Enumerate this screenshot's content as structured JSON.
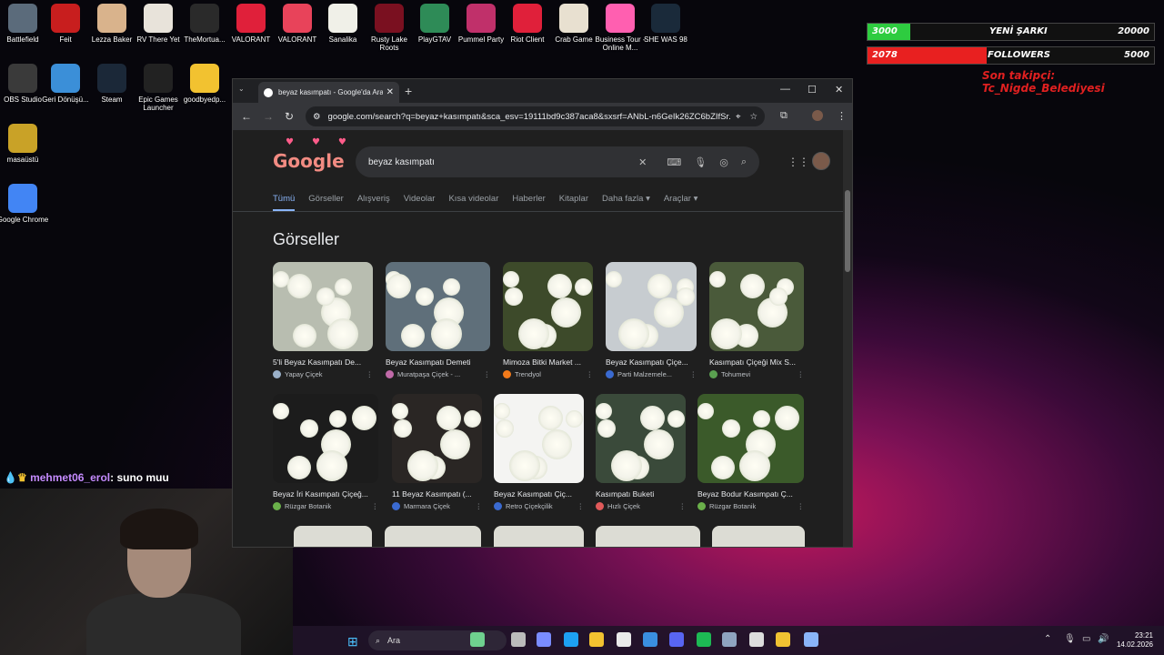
{
  "desktop": {
    "icons": [
      {
        "label": "Battlefield",
        "color": "#5b6b7b"
      },
      {
        "label": "Feit",
        "color": "#c81e1e"
      },
      {
        "label": "Lezza Baker",
        "color": "#d9b38c"
      },
      {
        "label": "RV There Yet",
        "color": "#e8e3da"
      },
      {
        "label": "TheMortua...",
        "color": "#2a2a2a"
      },
      {
        "label": "VALORANT",
        "color": "#e0203a"
      },
      {
        "label": "VALORANT",
        "color": "#e8435a"
      },
      {
        "label": "Sanalika",
        "color": "#f0f0e8"
      },
      {
        "label": "Rusty Lake Roots",
        "color": "#7a1020"
      },
      {
        "label": "PlayGTAV",
        "color": "#2e8b57"
      },
      {
        "label": "Pummel Party",
        "color": "#c0306a"
      },
      {
        "label": "Riot Client",
        "color": "#e0203a"
      },
      {
        "label": "Crab Game",
        "color": "#e8e0d0"
      },
      {
        "label": "Business Tour - Online M...",
        "color": "#ff5fb0"
      },
      {
        "label": "SHE WAS 98",
        "color": "#1a2a3a"
      },
      {
        "label": "OBS Studio",
        "color": "#3a3a3a"
      },
      {
        "label": "Geri Dönüşü...",
        "color": "#3b8fd8"
      },
      {
        "label": "Steam",
        "color": "#1b2838"
      },
      {
        "label": "Epic Games Launcher",
        "color": "#222"
      },
      {
        "label": "goodbyedp...",
        "color": "#f2c230"
      },
      {
        "label": "masaüstü",
        "color": "#c9a227"
      },
      {
        "label": "Google Chrome",
        "color": "#4285f4"
      }
    ]
  },
  "overlay": {
    "bar1": {
      "left": "3000",
      "label": "YENİ ŞARKI",
      "right": "20000",
      "fill": 0.15,
      "color": "#2ecc40"
    },
    "bar2": {
      "left": "2078",
      "label": "FOLLOWERS",
      "right": "5000",
      "fill": 0.415,
      "color": "#e82020"
    },
    "last_follower": "Son takipçi: Tc_Nigde_Belediyesi",
    "chat": {
      "user": "mehmet06_erol",
      "message": ": suno muu"
    }
  },
  "browser": {
    "tab_title": "beyaz kasımpatı - Google'da Ara",
    "url": "google.com/search?q=beyaz+kasımpatı&sca_esv=19111bd9c387aca8&sxsrf=ANbL-n6GeIk26ZC6bZIfSr...",
    "search_query": "beyaz kasımpatı",
    "logo": "Google",
    "filters": [
      "Tümü",
      "Görseller",
      "Alışveriş",
      "Videolar",
      "Kısa videolar",
      "Haberler",
      "Kitaplar",
      "Daha fazla ▾",
      "Araçlar ▾"
    ],
    "section_title": "Görseller",
    "images_row1": [
      {
        "caption": "5'li Beyaz Kasımpatı De...",
        "source": "Yapay Çiçek",
        "color": "#9ab0c8"
      },
      {
        "caption": "Beyaz Kasımpatı Demeti",
        "source": "Muratpaşa Çiçek - ...",
        "color": "#c06aa8"
      },
      {
        "caption": "Mimoza Bitki Market ...",
        "source": "Trendyol",
        "color": "#f27a1a"
      },
      {
        "caption": "Beyaz Kasımpatı Çiçe...",
        "source": "Parti Malzemele...",
        "color": "#3a6ad0"
      },
      {
        "caption": "Kasımpatı Çiçeği Mix S...",
        "source": "Tohumevi",
        "color": "#5aa050"
      }
    ],
    "images_row2": [
      {
        "caption": "Beyaz İri Kasımpatı Çiçeğ...",
        "source": "Rüzgar Botanik",
        "color": "#6ab04a"
      },
      {
        "caption": "11 Beyaz Kasımpatı (...",
        "source": "Marmara Çiçek",
        "color": "#3a6ad0"
      },
      {
        "caption": "Beyaz Kasımpatı Çiç...",
        "source": "Retro Çiçekçilik",
        "color": "#3a6ad0"
      },
      {
        "caption": "Kasımpatı Buketi",
        "source": "Hızlı Çiçek",
        "color": "#e05a5a"
      },
      {
        "caption": "Beyaz Bodur Kasımpatı Ç...",
        "source": "Rüzgar Botanik",
        "color": "#6ab04a"
      }
    ]
  },
  "taskbar": {
    "search_label": "Ara",
    "time": "23:21",
    "date": "14.02.2026"
  }
}
